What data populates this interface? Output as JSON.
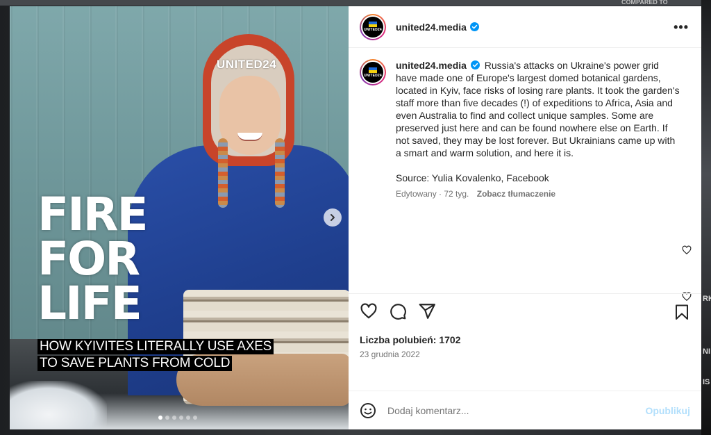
{
  "background": {
    "top_right_text": "COMPARED TO",
    "right_edge_text_1": "RKO",
    "right_edge_text_2": "NI",
    "right_edge_text_3": "IS"
  },
  "post": {
    "username": "united24.media",
    "verified": true,
    "avatar_label": "UNITED24",
    "more_icon": "more-horizontal-icon",
    "media": {
      "brand": "UNITED24",
      "title_lines": [
        "FIRE",
        "FOR",
        "LIFE"
      ],
      "subtitle_lines": [
        "HOW KYIVITES LITERALLY USE AXES",
        "TO SAVE PLANTS FROM COLD"
      ],
      "carousel_count": 6,
      "carousel_active": 0
    },
    "caption": {
      "username": "united24.media",
      "text": "Russia's attacks on Ukraine's power grid have made one of Europe's largest domed botanical gardens, located in Kyiv, face risks of losing rare plants. It took the garden's staff more than five decades (!) of expeditions to Africa, Asia and even Australia to find and collect unique samples. Some are preserved just here and can be found nowhere else on Earth. If not saved, they may be lost forever. But Ukrainians came up with a smart and warm solution, and here it is.",
      "source": "Source: Yulia Kovalenko, Facebook",
      "edited": "Edytowany · 72 tyg.",
      "translate": "Zobacz tłumaczenie"
    },
    "likes": "Liczba polubień: 1702",
    "date": "23 grudnia 2022",
    "comment_placeholder": "Dodaj komentarz...",
    "post_button": "Opublikuj"
  },
  "colors": {
    "verified_blue": "#0095f6",
    "post_disabled": "#b2dffc",
    "text": "#262626",
    "secondary": "#737373"
  }
}
